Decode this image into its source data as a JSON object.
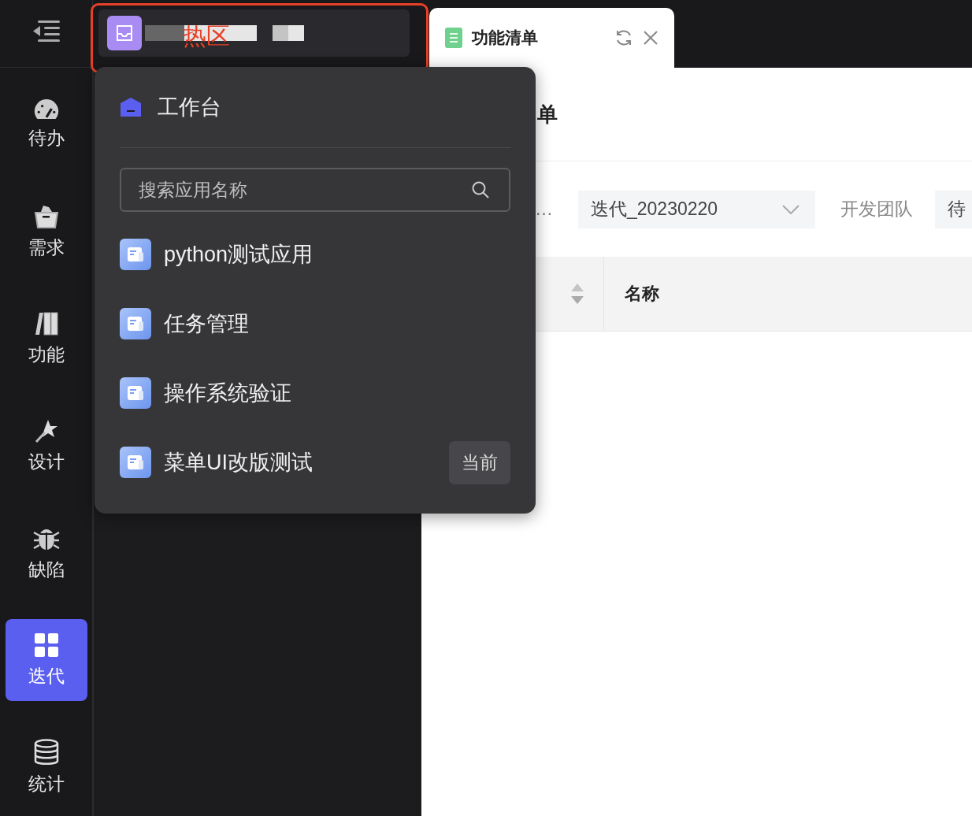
{
  "sidebar": {
    "items": [
      {
        "label": "待办",
        "selected": false
      },
      {
        "label": "需求",
        "selected": false
      },
      {
        "label": "功能",
        "selected": false
      },
      {
        "label": "设计",
        "selected": false
      },
      {
        "label": "缺陷",
        "selected": false
      },
      {
        "label": "迭代",
        "selected": true
      },
      {
        "label": "统计",
        "selected": false
      }
    ]
  },
  "hotspot": {
    "label": "热区"
  },
  "tabs": [
    {
      "title": "功能清单",
      "selected": true
    }
  ],
  "page": {
    "title": "单",
    "filters": {
      "field_1": "…",
      "iteration": "迭代_20230220",
      "team_label": "开发团队",
      "field_4": "待"
    },
    "table": {
      "columns": [
        "名称"
      ]
    }
  },
  "app_menu": {
    "workbench": "工作台",
    "search": {
      "placeholder": "搜索应用名称"
    },
    "apps": [
      {
        "name": "python测试应用"
      },
      {
        "name": "任务管理"
      },
      {
        "name": "操作系统验证"
      },
      {
        "name": "菜单UI改版测试",
        "badge": "当前"
      }
    ]
  }
}
